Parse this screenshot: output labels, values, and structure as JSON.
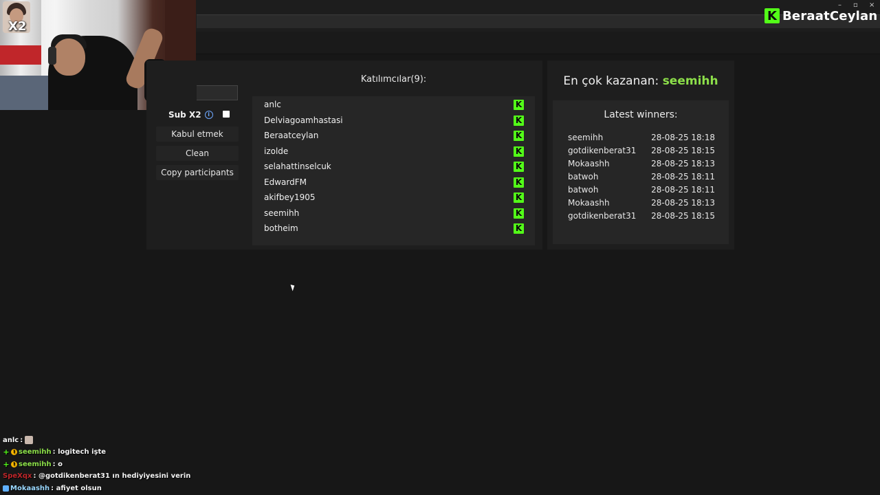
{
  "window": {
    "minimize_glyph": "–",
    "restore_glyph": "▫",
    "close_glyph": "×"
  },
  "brand": {
    "logo_letter": "K",
    "name": "BeraatCeylan"
  },
  "webcam": {
    "overlay_badge": "X2"
  },
  "controls": {
    "search_value": "",
    "sub_label": "Sub X2",
    "info_glyph": "i",
    "accept_label": "Kabul etmek",
    "clean_label": "Clean",
    "copy_label": "Copy participants"
  },
  "participants": {
    "title": "Katılımcılar(9):",
    "platform_icon": "K",
    "items": [
      "anlc",
      "Delviagoamhastasi",
      "Beraatceylan",
      "izolde",
      "selahattinselcuk",
      "EdwardFM",
      "akifbey1905",
      "seemihh",
      "botheim"
    ]
  },
  "top_winner": {
    "label": "En çok kazanan:",
    "name": "seemihh"
  },
  "latest_winners": {
    "title": "Latest winners:",
    "items": [
      {
        "name": "seemihh",
        "time": "28-08-25 18:18"
      },
      {
        "name": "gotdikenberat31",
        "time": "28-08-25 18:15"
      },
      {
        "name": "Mokaashh",
        "time": "28-08-25 18:13"
      },
      {
        "name": "batwoh",
        "time": "28-08-25 18:11"
      },
      {
        "name": "batwoh",
        "time": "28-08-25 18:11"
      },
      {
        "name": "Mokaashh",
        "time": "28-08-25 18:13"
      },
      {
        "name": "gotdikenberat31",
        "time": "28-08-25 18:15"
      }
    ]
  },
  "chat": {
    "colors": {
      "anlc": "#ffffff",
      "seemihh": "#8de04a",
      "SpeXqx": "#c0262a",
      "Mokaashh": "#9ad8ff"
    },
    "messages": [
      {
        "user": "anlc",
        "text": ":"
      },
      {
        "user": "seemihh",
        "text": ": logitech işte"
      },
      {
        "user": "seemihh",
        "text": ": o"
      },
      {
        "user": "SpeXqx",
        "text": ": @gotdikenberat31 ın hediyiyesini verin"
      },
      {
        "user": "Mokaashh",
        "text": ": afiyet olsun"
      }
    ],
    "badge_plus": "+",
    "badge_gold": "!"
  }
}
